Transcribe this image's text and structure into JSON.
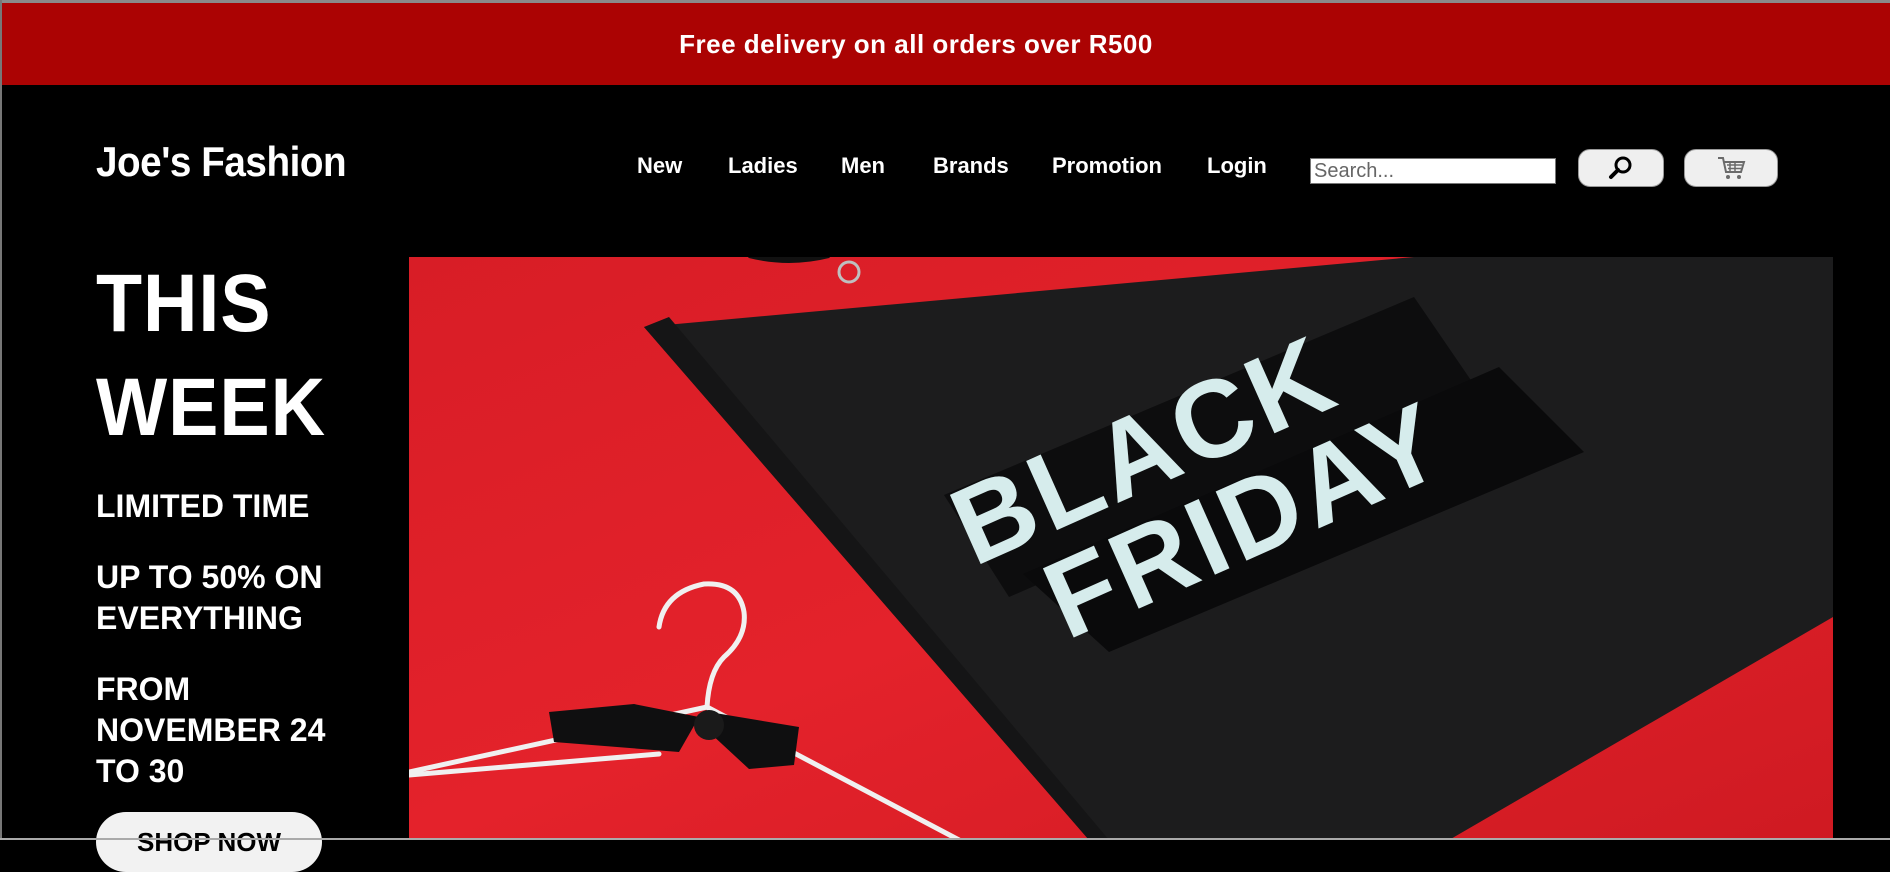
{
  "promo": {
    "text": "Free delivery on all orders over R500"
  },
  "header": {
    "brand": "Joe's Fashion",
    "nav": [
      {
        "label": "New"
      },
      {
        "label": "Ladies"
      },
      {
        "label": "Men"
      },
      {
        "label": "Brands"
      },
      {
        "label": "Promotion"
      },
      {
        "label": "Login"
      }
    ],
    "search": {
      "placeholder": "Search...",
      "value": "",
      "button_icon": "search-icon"
    },
    "cart": {
      "icon": "cart-icon"
    }
  },
  "hero": {
    "title_line1": "THIS",
    "title_line2": "WEEK",
    "line1": "LIMITED TIME",
    "line2a": "UP TO 50% ON",
    "line2b": "EVERYTHING",
    "line3a": "FROM",
    "line3b": "NOVEMBER 24",
    "line3c": "TO 30",
    "cta": "SHOP NOW",
    "image": {
      "bag_text_line1": "BLACK",
      "bag_text_line2": "FRIDAY"
    }
  },
  "colors": {
    "promo_bar": "#ab0303",
    "page_bg": "#000000",
    "hero_red": "#e0202a",
    "bag_text": "#d6ecec"
  }
}
